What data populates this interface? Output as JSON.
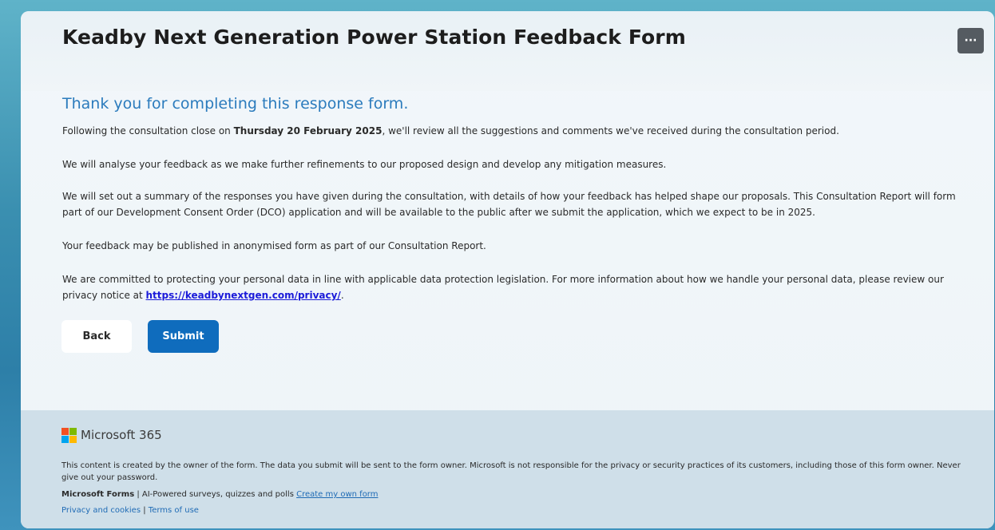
{
  "form": {
    "title": "Keadby Next Generation Power Station Feedback Form",
    "more_button_label": "···",
    "thanks_heading": "Thank you for completing this response form.",
    "p1_pre": "Following the consultation close on ",
    "p1_bold": "Thursday 20 February 2025",
    "p1_post": ", we'll review all the suggestions and comments we've received during the consultation period.",
    "p2": "We will analyse your feedback as we make further refinements to our proposed design and develop any mitigation measures.",
    "p3": "We will set out a summary of the responses you have given during the consultation, with details of how your feedback has helped shape our proposals. This Consultation Report will form part of our Development Consent Order (DCO) application and will be available to the public after we submit the application, which we expect to be in 2025.",
    "p4": "Your feedback may be published in anonymised form as part of our Consultation Report.",
    "p5_pre": "We are committed to protecting your personal data in line with applicable data protection legislation. For more information about how we handle your personal data, please review our privacy notice at ",
    "p5_link": "https://keadbynextgen.com/privacy/",
    "p5_post": ".",
    "back_label": "Back",
    "submit_label": "Submit"
  },
  "footer": {
    "brand": "Microsoft 365",
    "disclaimer": "This content is created by the owner of the form. The data you submit will be sent to the form owner. Microsoft is not responsible for the privacy or security practices of its customers, including those of this form owner. Never give out your password.",
    "forms_bold": "Microsoft Forms",
    "forms_tagline": " | AI-Powered surveys, quizzes and polls ",
    "create_link": "Create my own form",
    "privacy_link": "Privacy and cookies",
    "separator": " | ",
    "terms_link": "Terms of use"
  },
  "colors": {
    "accent": "#2b7bbd",
    "submit_bg": "#0f6cbd",
    "link": "#1b1bd9"
  }
}
